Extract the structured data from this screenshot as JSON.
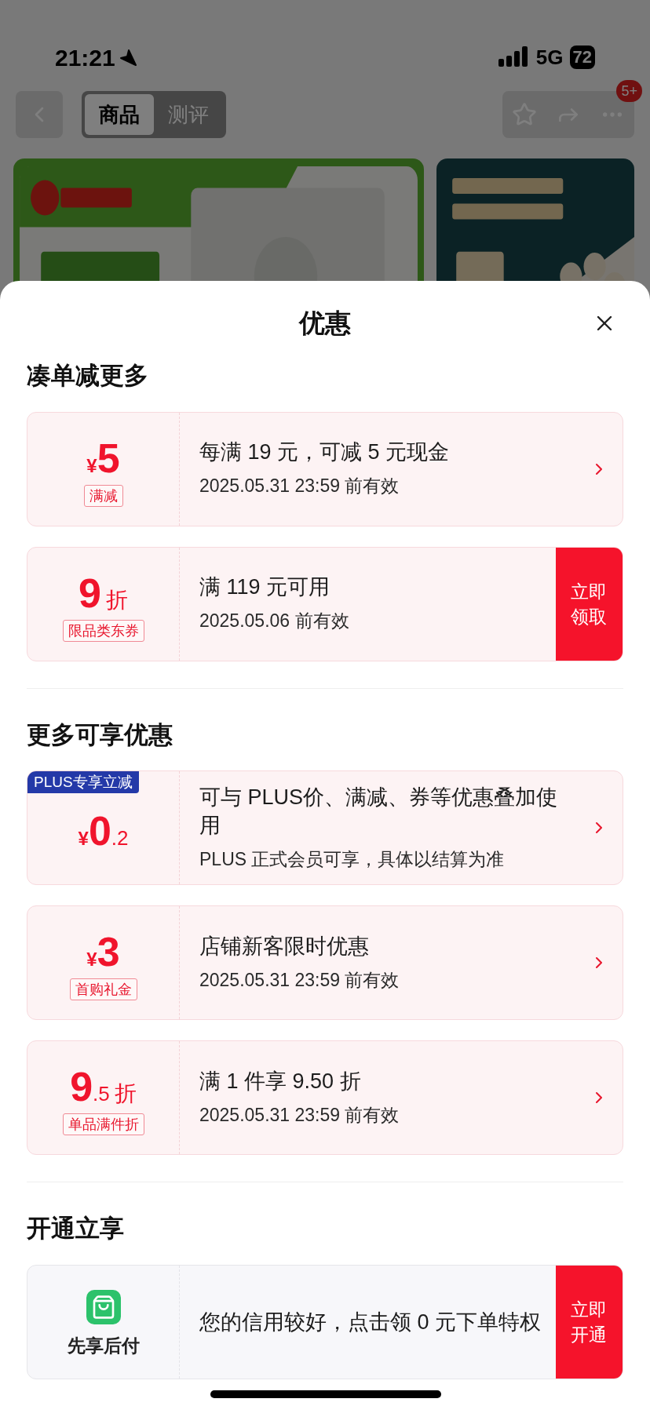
{
  "status_bar": {
    "time": "21:21",
    "network": "5G",
    "battery": "72"
  },
  "nav": {
    "tabs": [
      {
        "label": "商品",
        "selected": true
      },
      {
        "label": "测评",
        "selected": false
      }
    ],
    "badge": "5+"
  },
  "sheet": {
    "title": "优惠",
    "sections": [
      {
        "title": "凑单减更多",
        "cards": [
          {
            "kind": "coupon",
            "currency": "¥",
            "amount": "5",
            "tag": "满减",
            "title": "每满 19 元，可减 5 元现金",
            "subtitle": "2025.05.31 23:59 前有效"
          },
          {
            "kind": "coupon",
            "amount": "9",
            "unit": "折",
            "tag": "限品类东券",
            "title": "满 119 元可用",
            "subtitle": "2025.05.06 前有效",
            "action": "立即领取"
          }
        ]
      },
      {
        "title": "更多可享优惠",
        "cards": [
          {
            "kind": "coupon",
            "ribbon": "PLUS专享立减",
            "currency": "¥",
            "amount": "0",
            "fraction": ".2",
            "title": "可与 PLUS价、满减、券等优惠叠加使用",
            "subtitle": "PLUS 正式会员可享，具体以结算为准"
          },
          {
            "kind": "coupon",
            "currency": "¥",
            "amount": "3",
            "tag": "首购礼金",
            "title": "店铺新客限时优惠",
            "subtitle": "2025.05.31 23:59 前有效"
          },
          {
            "kind": "coupon",
            "amount": "9",
            "fraction": ".5",
            "unit": "折",
            "tag": "单品满件折",
            "title": "满 1 件享 9.50 折",
            "subtitle": "2025.05.31 23:59 前有效"
          }
        ]
      },
      {
        "title": "开通立享",
        "cards": [
          {
            "kind": "service",
            "label": "先享后付",
            "title": "您的信用较好，点击领 0 元下单特权",
            "action": "立即开通"
          }
        ]
      }
    ]
  }
}
